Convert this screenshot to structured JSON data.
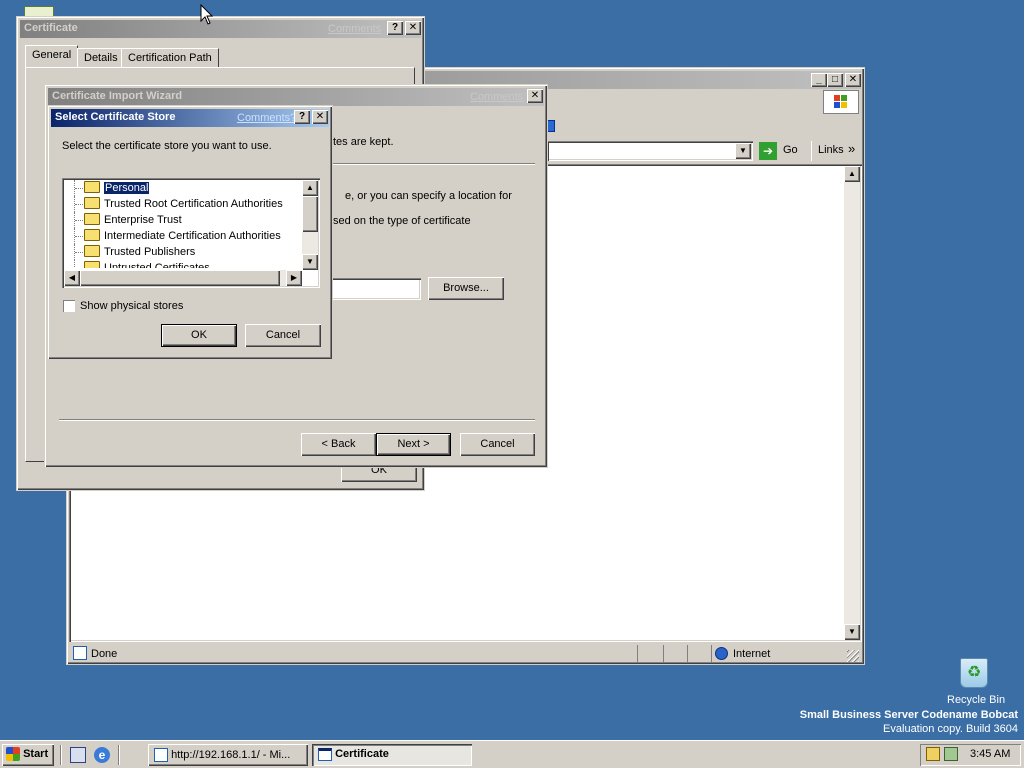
{
  "ie_window": {
    "go_label": "Go",
    "links_label": "Links",
    "links_chevron": "»",
    "status_text": "Done",
    "zone_text": "Internet"
  },
  "cert_dialog": {
    "title": "Certificate",
    "comments_label": "Comments",
    "tabs": [
      "General",
      "Details",
      "Certification Path"
    ],
    "ok_label": "OK"
  },
  "wizard": {
    "title": "Certificate Import Wizard",
    "comments_label": "Comments",
    "partial_line_1": "tes are kept.",
    "partial_line_2": "e, or you can specify a location for",
    "partial_line_3": "sed on the type of certificate",
    "browse_label": "Browse...",
    "back_label": "< Back",
    "next_label": "Next >",
    "cancel_label": "Cancel"
  },
  "store_dialog": {
    "title": "Select Certificate Store",
    "comments_label": "Comments?",
    "help_glyph": "?",
    "close_glyph": "✕",
    "prompt": "Select the certificate store you want to use.",
    "stores": [
      "Personal",
      "Trusted Root Certification Authorities",
      "Enterprise Trust",
      "Intermediate Certification Authorities",
      "Trusted Publishers",
      "Untrusted Certificates"
    ],
    "selected_index": 0,
    "show_physical_label": "Show physical stores",
    "show_physical_checked": false,
    "ok_label": "OK",
    "cancel_label": "Cancel"
  },
  "desktop": {
    "recycle_bin_label": "Recycle Bin",
    "os_line_1": "Small Business Server Codename Bobcat",
    "os_line_2": "Evaluation copy. Build 3604"
  },
  "taskbar": {
    "start_label": "Start",
    "tasks": [
      "http://192.168.1.1/ - Mi...",
      "Certificate"
    ],
    "active_task_index": 1,
    "clock": "3:45 AM"
  }
}
